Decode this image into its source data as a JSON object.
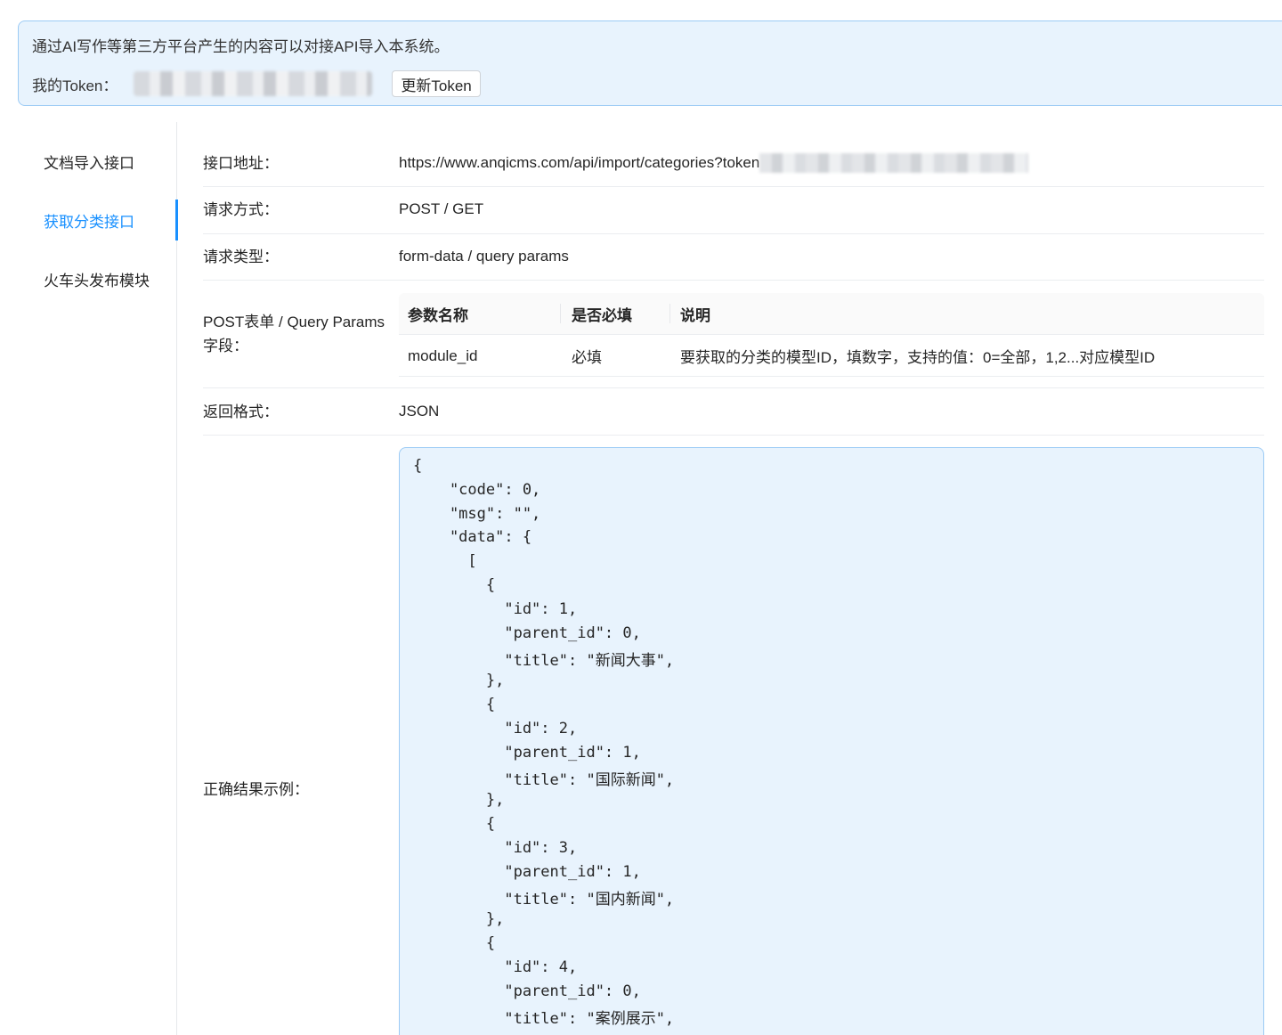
{
  "alert": {
    "message": "通过AI写作等第三方平台产生的内容可以对接API导入本系统。",
    "token_label": "我的Token：",
    "refresh_button": "更新Token"
  },
  "sidebar": {
    "items": [
      {
        "label": "文档导入接口",
        "active": false
      },
      {
        "label": "获取分类接口",
        "active": true
      },
      {
        "label": "火车头发布模块",
        "active": false
      }
    ]
  },
  "api": {
    "url_label": "接口地址：",
    "url": "https://www.anqicms.com/api/import/categories?token",
    "method_label": "请求方式：",
    "method": "POST / GET",
    "type_label": "请求类型：",
    "type": "form-data / query params",
    "fields_label_line1": "POST表单 / Query Params",
    "fields_label_line2": "字段：",
    "table": {
      "headers": [
        "参数名称",
        "是否必填",
        "说明"
      ],
      "rows": [
        [
          "module_id",
          "必填",
          "要获取的分类的模型ID，填数字，支持的值：0=全部，1,2...对应模型ID"
        ]
      ]
    },
    "format_label": "返回格式：",
    "format": "JSON",
    "example_label": "正确结果示例：",
    "example_lines": [
      "{",
      "    \"code\": 0,",
      "    \"msg\": \"\",",
      "    \"data\": {",
      "      [",
      "        {",
      "          \"id\": 1,",
      "          \"parent_id\": 0,",
      "          \"title\": \"新闻大事\",",
      "        },",
      "        {",
      "          \"id\": 2,",
      "          \"parent_id\": 1,",
      "          \"title\": \"国际新闻\",",
      "        },",
      "        {",
      "          \"id\": 3,",
      "          \"parent_id\": 1,",
      "          \"title\": \"国内新闻\",",
      "        },",
      "        {",
      "          \"id\": 4,",
      "          \"parent_id\": 0,",
      "          \"title\": \"案例展示\","
    ]
  },
  "colors": {
    "accent": "#1890ff",
    "alert_bg": "#e8f3fd",
    "alert_border": "#9ccbf5"
  }
}
